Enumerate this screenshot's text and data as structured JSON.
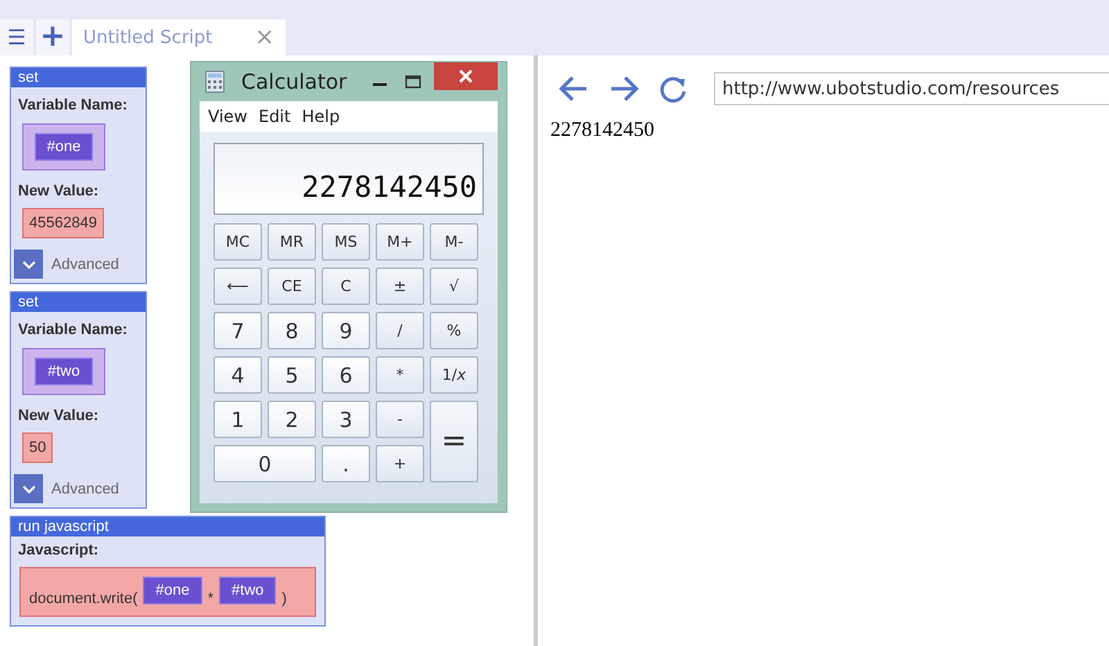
{
  "tabbar": {
    "menu_button": "☰",
    "new_button": "+",
    "tab": {
      "label": "Untitled Script",
      "close": "×"
    }
  },
  "blocks": [
    {
      "kind": "set",
      "title": "set",
      "variable_label": "Variable Name:",
      "variable": "#one",
      "value_label": "New Value:",
      "value": "45562849",
      "advanced": "Advanced"
    },
    {
      "kind": "set",
      "title": "set",
      "variable_label": "Variable Name:",
      "variable": "#two",
      "value_label": "New Value:",
      "value": "50",
      "advanced": "Advanced"
    },
    {
      "kind": "javascript",
      "title": "run javascript",
      "label": "Javascript:",
      "parts": [
        {
          "kind": "text",
          "text": "document.write("
        },
        {
          "kind": "variable",
          "text": "#one"
        },
        {
          "kind": "text",
          "text": "*"
        },
        {
          "kind": "variable",
          "text": "#two"
        },
        {
          "kind": "text",
          "text": ")"
        }
      ]
    }
  ],
  "calculator": {
    "title": "Calculator",
    "menu": [
      "View",
      "Edit",
      "Help"
    ],
    "display": "2278142450",
    "keys": [
      {
        "label": "MC",
        "kind": "memory"
      },
      {
        "label": "MR",
        "kind": "memory"
      },
      {
        "label": "MS",
        "kind": "memory"
      },
      {
        "label": "M+",
        "kind": "memory"
      },
      {
        "label": "M-",
        "kind": "memory"
      },
      {
        "label": "⟵",
        "kind": "op"
      },
      {
        "label": "CE",
        "kind": "op"
      },
      {
        "label": "C",
        "kind": "op"
      },
      {
        "label": "±",
        "kind": "op"
      },
      {
        "label": "√",
        "kind": "op"
      },
      {
        "label": "7",
        "kind": "digit"
      },
      {
        "label": "8",
        "kind": "digit"
      },
      {
        "label": "9",
        "kind": "digit"
      },
      {
        "label": "/",
        "kind": "op"
      },
      {
        "label": "%",
        "kind": "op"
      },
      {
        "label": "4",
        "kind": "digit"
      },
      {
        "label": "5",
        "kind": "digit"
      },
      {
        "label": "6",
        "kind": "digit"
      },
      {
        "label": "*",
        "kind": "op"
      },
      {
        "label": "1/*x*",
        "kind": "op"
      },
      {
        "label": "1",
        "kind": "digit"
      },
      {
        "label": "2",
        "kind": "digit"
      },
      {
        "label": "3",
        "kind": "digit"
      },
      {
        "label": "-",
        "kind": "op"
      },
      {
        "label": "=",
        "kind": "equals"
      },
      {
        "label": "0",
        "kind": "zero"
      },
      {
        "label": ".",
        "kind": "digit"
      },
      {
        "label": "+",
        "kind": "op"
      }
    ]
  },
  "browser": {
    "url": "http://www.ubotstudio.com/resources",
    "content": "2278142450"
  }
}
